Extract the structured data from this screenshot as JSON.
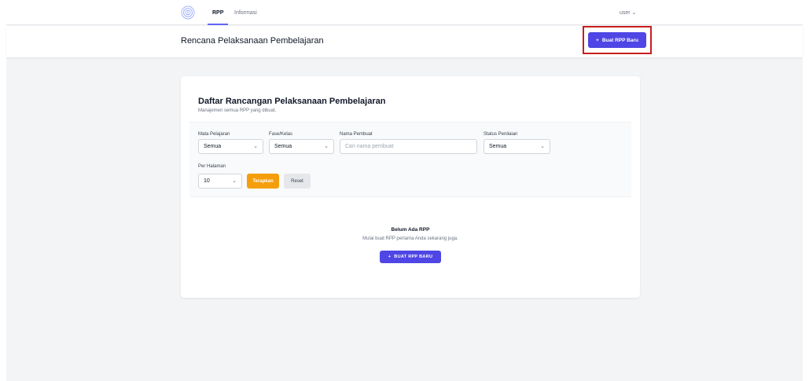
{
  "nav": {
    "tabs": [
      {
        "label": "RPP",
        "active": true
      },
      {
        "label": "Informasi",
        "active": false
      }
    ],
    "user_label": "user",
    "user_chevron": "chevron-down-icon",
    "logo_icon": "fingerprint-logo-icon"
  },
  "header": {
    "title": "Rencana Pelaksanaan Pembelajaran",
    "create_button": "Buat RPP Baru",
    "highlight_color": "#c81e1e"
  },
  "card": {
    "title": "Daftar Rancangan Pelaksanaan Pembelajaran",
    "subtitle": "Manajemen semua RPP yang dibuat."
  },
  "filters": {
    "subject": {
      "label": "Mata Pelajaran",
      "value": "Semua"
    },
    "phase": {
      "label": "Fase/Kelas",
      "value": "Semua"
    },
    "author": {
      "label": "Nama Pembuat",
      "value": "",
      "placeholder": "Cari nama pembuat"
    },
    "status": {
      "label": "Status Penilaian",
      "value": "Semua"
    },
    "per_page": {
      "label": "Per Halaman",
      "value": "10"
    },
    "apply_label": "Terapkan",
    "reset_label": "Reset"
  },
  "empty": {
    "title": "Belum Ada RPP",
    "message": "Mulai buat RPP pertama Anda sekarang juga.",
    "button": "BUAT RPP BARU"
  },
  "colors": {
    "primary": "#4f46e5",
    "apply": "#f59e0b",
    "background": "#f3f4f6"
  }
}
